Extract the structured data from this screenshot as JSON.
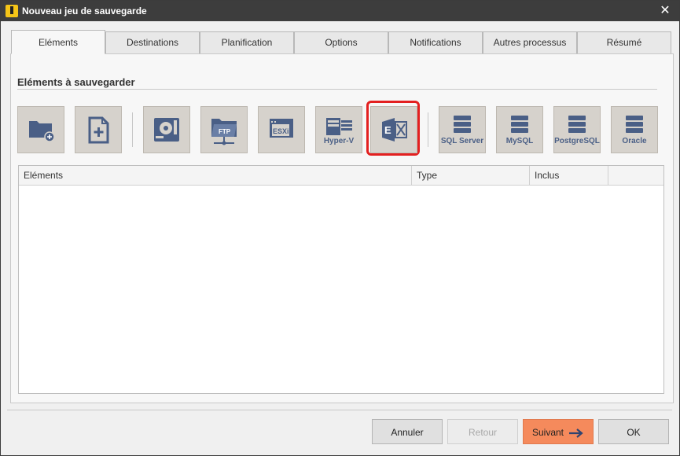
{
  "window": {
    "title": "Nouveau jeu de sauvegarde",
    "close_glyph": "✕"
  },
  "tabs": [
    {
      "label": "Eléments"
    },
    {
      "label": "Destinations"
    },
    {
      "label": "Planification"
    },
    {
      "label": "Options"
    },
    {
      "label": "Notifications"
    },
    {
      "label": "Autres processus"
    },
    {
      "label": "Résumé"
    }
  ],
  "section": {
    "title": "Eléments à sauvegarder"
  },
  "tools": [
    {
      "icon": "folder-add-icon"
    },
    {
      "icon": "file-add-icon"
    },
    {
      "icon": "disk-image-icon"
    },
    {
      "icon": "ftp-folder-icon",
      "label": "FTP"
    },
    {
      "icon": "esxi-icon",
      "label": "ESXi"
    },
    {
      "icon": "hyper-v-icon",
      "label": "Hyper-V"
    },
    {
      "icon": "exchange-icon"
    },
    {
      "icon": "database-icon",
      "label": "SQL Server"
    },
    {
      "icon": "database-icon",
      "label": "MySQL"
    },
    {
      "icon": "database-icon",
      "label": "PostgreSQL"
    },
    {
      "icon": "database-icon",
      "label": "Oracle"
    }
  ],
  "list": {
    "columns": [
      "Eléments",
      "Type",
      "Inclus"
    ]
  },
  "buttons": {
    "cancel": "Annuler",
    "back": "Retour",
    "next": "Suivant",
    "ok": "OK"
  },
  "colors": {
    "icon": "#4a5f86",
    "tool_bg": "#d6d2cc",
    "highlight": "#e32020",
    "primary": "#f58a5c"
  }
}
